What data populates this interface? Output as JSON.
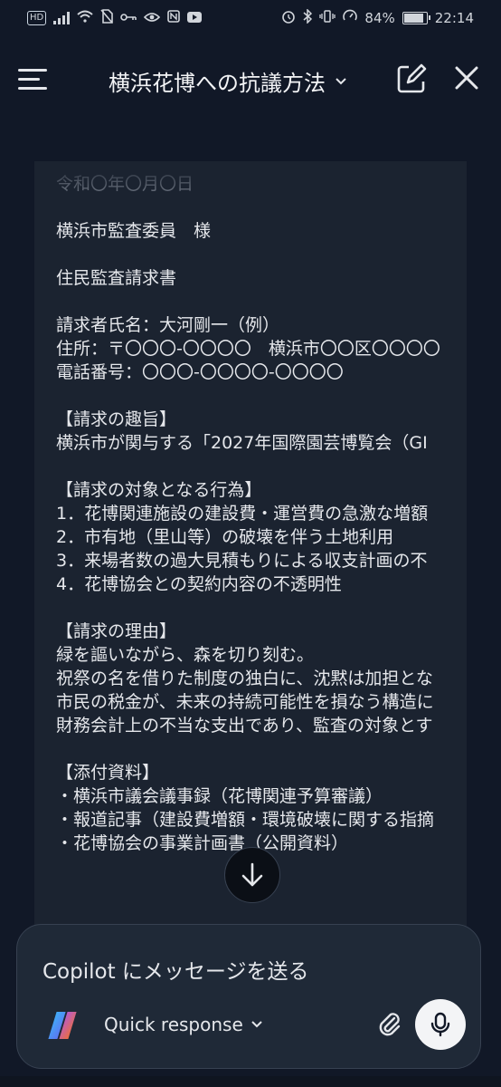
{
  "status_bar": {
    "hd": "HD",
    "battery": "84%",
    "time": "22:14"
  },
  "header": {
    "title": "横浜花博への抗議方法"
  },
  "document": {
    "lines": [
      "令和〇年〇月〇日",
      "",
      "横浜市監査委員　様",
      "",
      "住民監査請求書",
      "",
      "請求者氏名：大河剛一（例）",
      "住所：〒〇〇〇-〇〇〇〇　横浜市〇〇区〇〇〇〇",
      "電話番号：〇〇〇-〇〇〇〇-〇〇〇〇",
      "",
      "【請求の趣旨】",
      "横浜市が関与する「2027年国際園芸博覧会（GI",
      "",
      "【請求の対象となる行為】",
      "1．花博関連施設の建設費・運営費の急激な増額",
      "2．市有地（里山等）の破壊を伴う土地利用",
      "3．来場者数の過大見積もりによる収支計画の不",
      "4．花博協会との契約内容の不透明性",
      "",
      "【請求の理由】",
      "緑を謳いながら、森を切り刻む。",
      "祝祭の名を借りた制度の独白に、沈黙は加担とな",
      "市民の税金が、未来の持続可能性を損なう構造に",
      "財務会計上の不当な支出であり、監査の対象とす",
      "",
      "【添付資料】",
      "・横浜市議会議事録（花博関連予算審議）",
      "・報道記事（建設費増額・環境破壊に関する指摘",
      "・花博協会の事業計画書（公開資料）"
    ]
  },
  "composer": {
    "placeholder": "Copilot にメッセージを送る",
    "mode": "Quick response"
  },
  "icons": {
    "menu": "hamburger-menu-icon",
    "dropdown": "chevron-down-icon",
    "edit": "edit-note-icon",
    "close": "close-icon",
    "scroll": "arrow-down-icon",
    "attach": "paperclip-icon",
    "mic": "microphone-icon",
    "logo": "copilot-logo-icon"
  },
  "colors": {
    "background": "#111827",
    "card": "#1b2330",
    "composer": "#1f2937"
  }
}
